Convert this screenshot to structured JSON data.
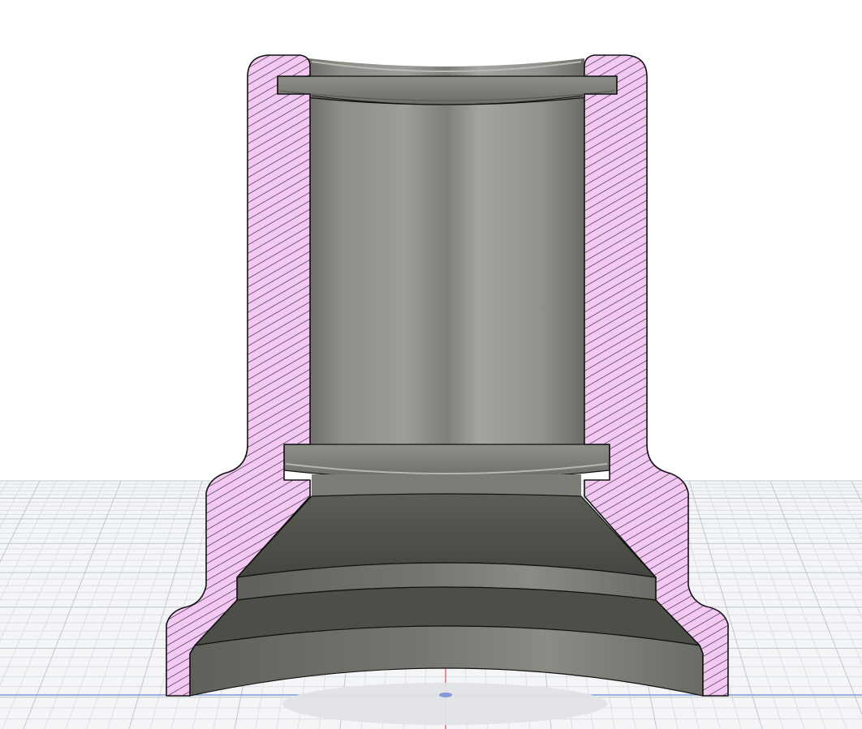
{
  "viewport": {
    "view_name": "3D section view",
    "model": "cylindrical-coupling-section"
  },
  "colors": {
    "background": "#ffffff",
    "grid_fine": "#dcdfe4",
    "grid_major": "#b9bec6",
    "axis_x": "#6b86d6",
    "axis_y": "#e05a5a",
    "section_fill": "#f3c8f3",
    "section_hatch": "#1e1e1e",
    "outline": "#111111",
    "metal_light": "#9a9c96",
    "metal_mid": "#777872",
    "metal_dark": "#4c4c48",
    "shadow": "#e4e5e7"
  },
  "icons": {
    "origin": "origin-marker-icon"
  }
}
